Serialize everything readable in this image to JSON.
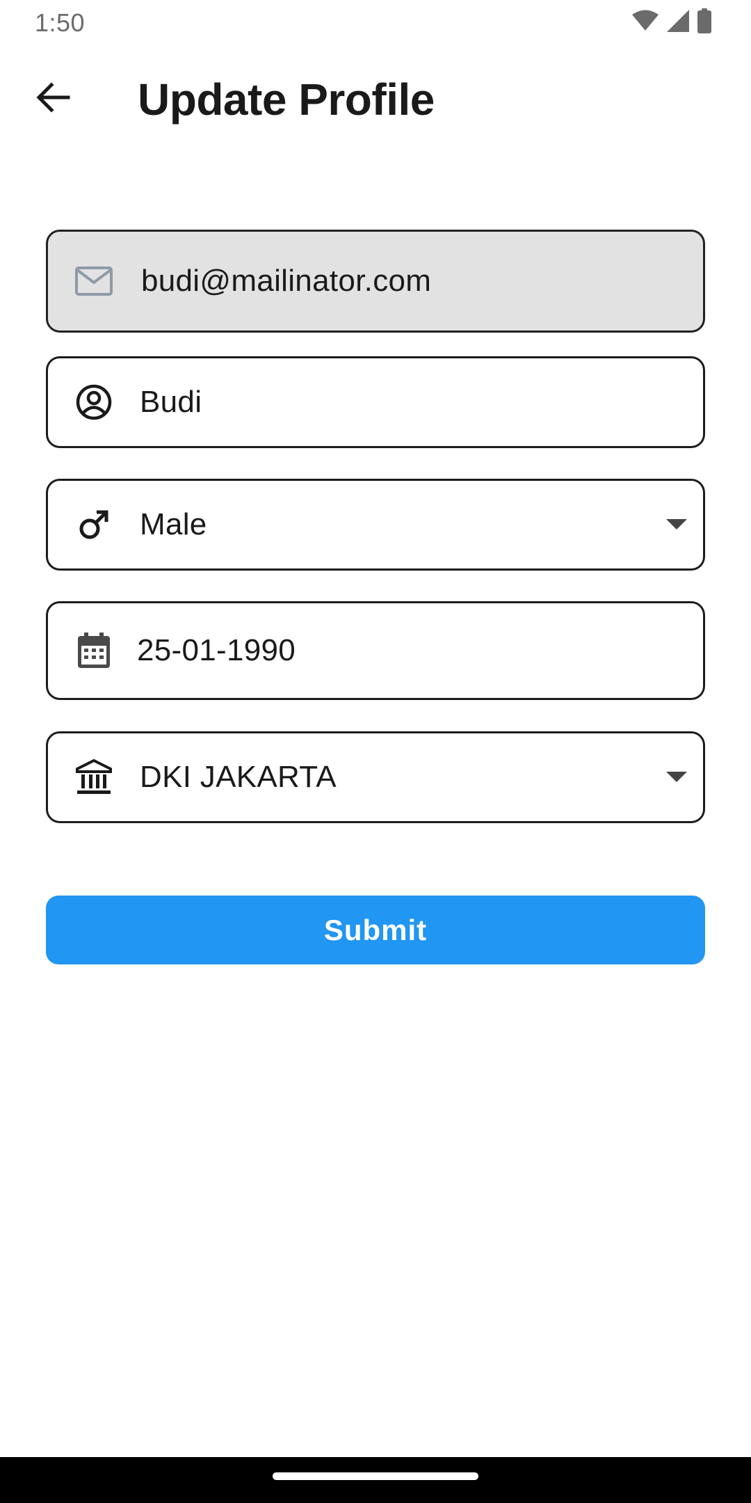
{
  "status_bar": {
    "time": "1:50",
    "icons": [
      "wifi-icon",
      "signal-icon",
      "battery-icon"
    ]
  },
  "app_bar": {
    "title": "Update Profile",
    "back_icon": "arrow-back-icon"
  },
  "form": {
    "email": {
      "value": "budi@mailinator.com",
      "icon": "mail-icon",
      "disabled": true
    },
    "name": {
      "value": "Budi",
      "icon": "account-circle-icon"
    },
    "gender": {
      "value": "Male",
      "icon": "male-icon",
      "dropdown": true
    },
    "birth_date": {
      "value": "25-01-1990",
      "icon": "calendar-icon"
    },
    "province": {
      "value": "DKI JAKARTA",
      "icon": "bank-icon",
      "dropdown": true
    }
  },
  "submit": {
    "label": "Submit"
  },
  "colors": {
    "accent": "#2196f3",
    "disabled_field_bg": "#e2e2e2",
    "text": "#1a1a1a",
    "nav_bar": "#000000"
  }
}
